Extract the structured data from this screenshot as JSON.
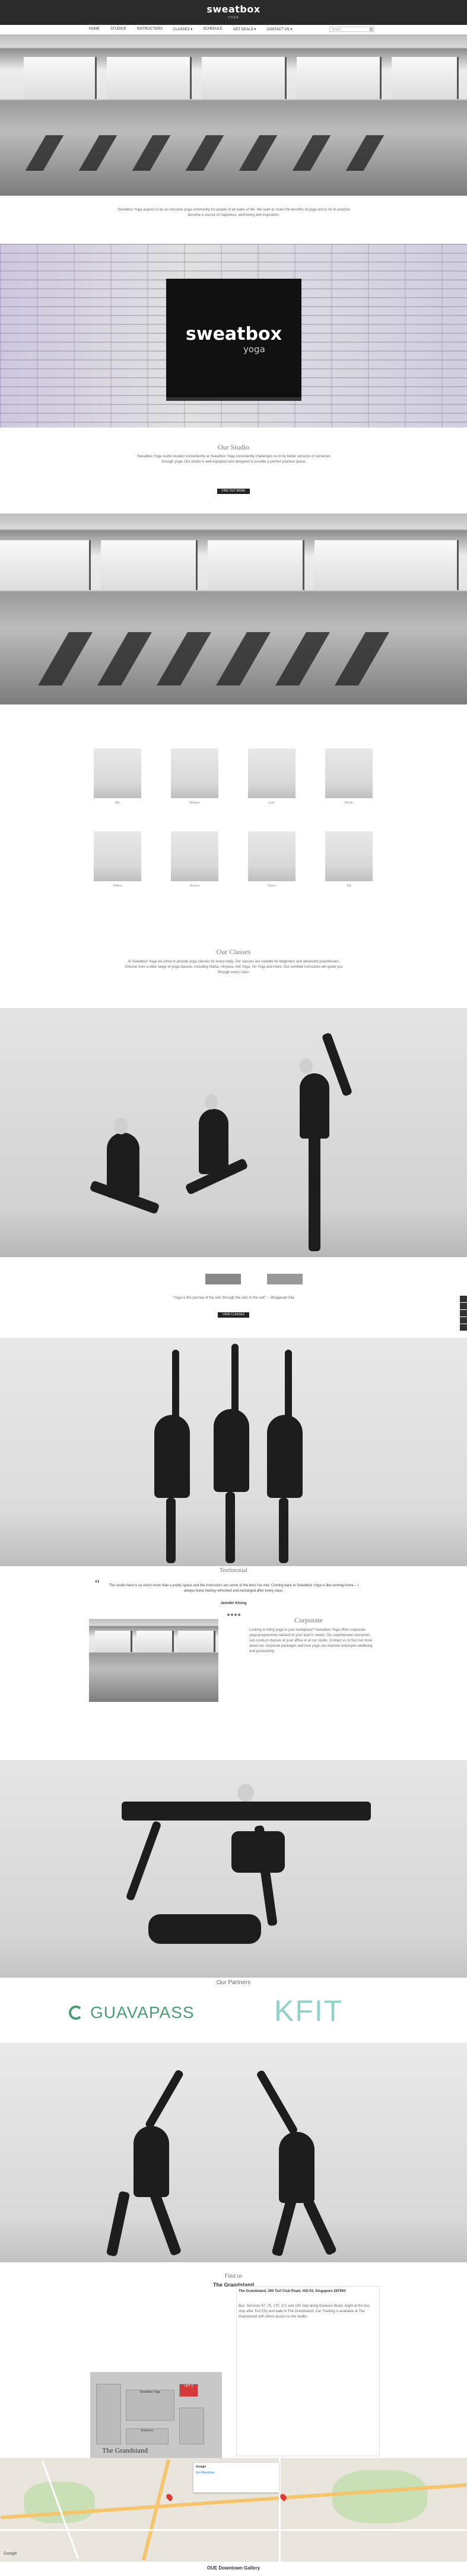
{
  "brand": {
    "name": "sweatbox",
    "sub": "YOGA"
  },
  "nav": {
    "items": [
      "HOME",
      "STUDIOS",
      "INSTRUCTORS",
      "CLASSES ▾",
      "SCHEDULE",
      "GET DEALS ▾",
      "CONTACT US ▾"
    ],
    "search_placeholder": "Search"
  },
  "intro": {
    "text": "Sweatbox Yoga aspires to be an inclusive yoga community for people of all walks of life. We seek to share the benefits of yoga and to let its practice become a source of happiness, well-being and inspiration."
  },
  "studios": {
    "sign_text": "sweatbox",
    "sign_sub": "yoga",
    "heading": "Our Studio",
    "text": "Sweatbox Yoga studio located conveniently at Sweatbox Yoga consistently challenges us to be better versions of ourselves through yoga. Our studio is well-equipped and designed to provide a perfect practice space.",
    "button": "FIND OUT MORE"
  },
  "instructors": [
    {
      "name": "Ally"
    },
    {
      "name": "Melanie"
    },
    {
      "name": "Lynn"
    },
    {
      "name": "Nicole"
    },
    {
      "name": "Maleia"
    },
    {
      "name": "Jessica"
    },
    {
      "name": "Vivien"
    },
    {
      "name": "Kat"
    }
  ],
  "classes": {
    "heading": "Our Classes",
    "text": "At Sweatbox Yoga we strive to provide yoga classes for every body. Our classes are suitable for beginners and advanced practitioners. Choose from a wide range of yoga classes, including Hatha, Vinyasa, Hot Yoga, Yin Yoga and more. Our certified instructors will guide you through every class.",
    "quote": "\"Yoga is the journey of the self, through the self, to the self.\" – Bhagavad Gita",
    "button": "VIEW CLASSES"
  },
  "testimonial": {
    "heading": "Testimonial",
    "text": "The studio here is so much more than a pretty space and the instructors are some of the best I've met. Coming back to Sweatbox Yoga is like coming home – I always leave feeling refreshed and recharged after every class.",
    "author": "Jennifer Khong"
  },
  "corporate": {
    "heading": "Corporate",
    "text": "Looking to bring yoga to your workplace? Sweatbox Yoga offers corporate yoga programmes tailored to your team's needs. Our experienced instructors can conduct classes at your office or at our studio. Contact us to find out more about our corporate packages and how yoga can improve employee wellbeing and productivity."
  },
  "partners": {
    "heading": "Our Partners",
    "guava": "GUAVAPASS",
    "kfit": "KFIT"
  },
  "findus": {
    "heading": "Find us",
    "location_name": "The Grandstand",
    "address_text": "The Grandstand, 200 Turf Club Road, #02-03, Singapore 287994",
    "directions_text": "Bus: Services 67, 75, 170, 171 and 190 stop along Dunearn Road. Alight at the bus stop after Turf City and walk to The Grandstand. Car: Parking is available at The Grandstand with direct access to the studio.",
    "map_card_title": "Google",
    "map_card_text": "Get Directions",
    "map_labels": {
      "grandstand": "The Grandstand",
      "entrance": "Entrance",
      "lift": "LIFT 2",
      "studio": "Sweatbox Yoga"
    },
    "bottom_label": "OUE Downtown Gallery"
  }
}
